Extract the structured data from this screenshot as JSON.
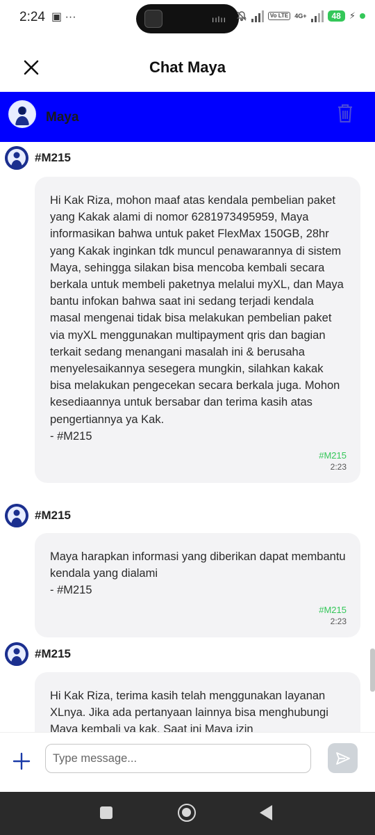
{
  "status_bar": {
    "time": "2:24",
    "left_icons": "▣ ···",
    "net": "4G+",
    "volte": "Vo LTE",
    "battery": "48",
    "icons": [
      "notifications-off-icon",
      "signal-icon",
      "volte-icon",
      "signal-icon",
      "battery-icon",
      "charging-icon"
    ]
  },
  "header": {
    "title": "Chat Maya",
    "close_icon": "close-icon"
  },
  "agent_bar": {
    "name": "Maya",
    "bg_color": "#0000ff",
    "trash_icon": "trash-icon"
  },
  "messages": [
    {
      "sender": "#M215",
      "text": "Hi Kak Riza, mohon maaf atas kendala pembelian paket yang Kakak alami di nomor 6281973495959, Maya informasikan bahwa untuk paket FlexMax 150GB, 28hr yang Kakak inginkan tdk muncul penawarannya di sistem Maya, sehingga silakan bisa mencoba kembali secara berkala untuk membeli paketnya melalui myXL, dan Maya bantu infokan bahwa saat ini sedang terjadi kendala masal mengenai tidak bisa melakukan pembelian paket via myXL menggunakan multipayment qris dan bagian terkait sedang menangani masalah ini & berusaha menyelesaikannya sesegera mungkin, silahkan kakak bisa melakukan pengecekan secara berkala juga. Mohon kesediaannya untuk bersabar dan terima kasih atas pengertiannya ya Kak.\n- #M215",
      "tag": "#M215",
      "time": "2:23"
    },
    {
      "sender": "#M215",
      "text": "Maya harapkan informasi yang diberikan dapat membantu kendala yang dialami\n- #M215",
      "tag": "#M215",
      "time": "2:23"
    },
    {
      "sender": "#M215",
      "text": "Hi Kak Riza, terima kasih telah menggunakan layanan XLnya. Jika ada pertanyaan lainnya bisa menghubungi Maya kembali ya kak. Saat ini Maya izin",
      "tag": "",
      "time": ""
    }
  ],
  "composer": {
    "placeholder": "Type message...",
    "value": "",
    "plus_icon": "plus-icon",
    "send_icon": "send-icon"
  },
  "nav_bar": {
    "icons": [
      "recents-icon",
      "home-icon",
      "back-icon"
    ]
  },
  "colors": {
    "accent_blue": "#0000ff",
    "tag_green": "#34c759",
    "bubble_bg": "#f3f3f5"
  }
}
